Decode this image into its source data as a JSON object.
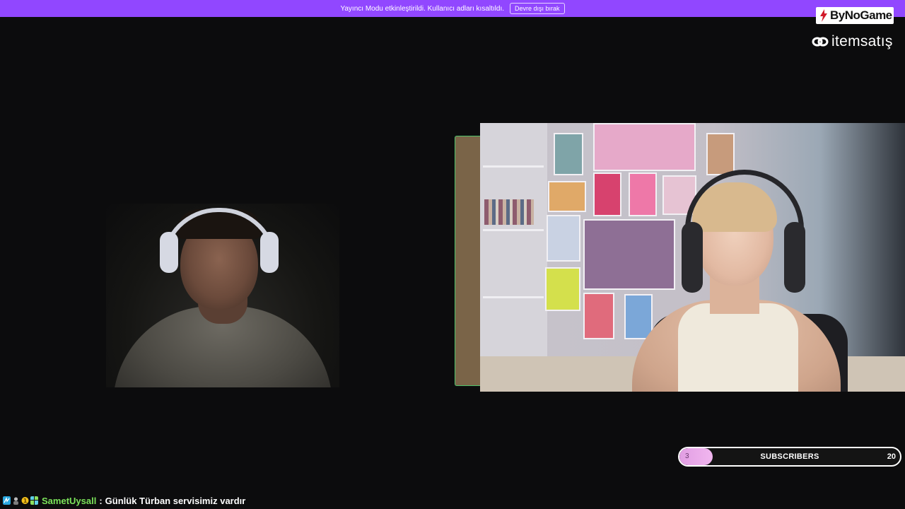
{
  "banner": {
    "message": "Yayıncı Modu etkinleştirildi. Kullanıcı adları kısaltıldı.",
    "button_label": "Devre dışı bırak"
  },
  "sponsors": {
    "logo1": "ByNoGame",
    "logo2": "itemsatış"
  },
  "subscribers": {
    "label": "SUBSCRIBERS",
    "current": "3",
    "goal": "20",
    "progress": 0.15
  },
  "chat": {
    "username": "SametUysall",
    "separator": ":",
    "message": "Günlük Türban servisimiz vardır",
    "badges": [
      "prime-badge",
      "user-badge",
      "bits-badge",
      "subscriber-badge"
    ]
  },
  "colors": {
    "banner": "#9147ff",
    "username": "#7be35a",
    "progress_fill": "#e19ee3",
    "cam_border": "#4fc36b"
  }
}
